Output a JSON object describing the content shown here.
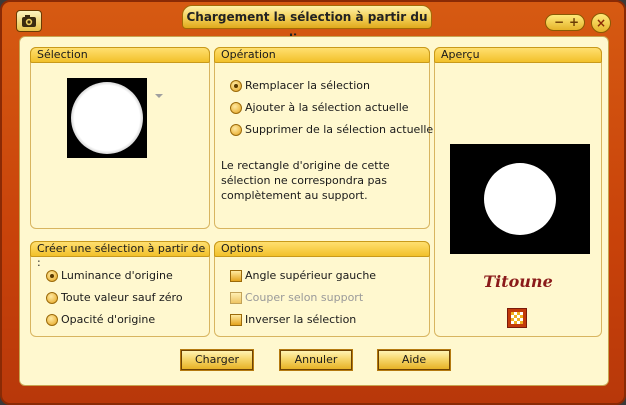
{
  "window": {
    "title": "Chargement la sélection à partir du disque"
  },
  "controls": {
    "minimize": "−",
    "maximize": "+",
    "close": "×"
  },
  "groups": {
    "selection": {
      "label": "Sélection"
    },
    "operation": {
      "label": "Opération",
      "options": [
        "Remplacer la sélection",
        "Ajouter à la sélection actuelle",
        "Supprimer de la sélection actuelle"
      ],
      "selected_index": 0,
      "description": "Le rectangle d'origine de cette sélection ne correspondra pas complètement au support."
    },
    "preview": {
      "label": "Aperçu",
      "watermark": "Titoune"
    },
    "create_from": {
      "label": "Créer une sélection à partir de :",
      "options": [
        "Luminance d'origine",
        "Toute valeur sauf zéro",
        "Opacité d'origine"
      ],
      "selected_index": 0
    },
    "options": {
      "label": "Options",
      "checkboxes": [
        {
          "label": "Angle supérieur gauche",
          "checked": false,
          "enabled": true
        },
        {
          "label": "Couper selon support",
          "checked": false,
          "enabled": false
        },
        {
          "label": "Inverser la sélection",
          "checked": false,
          "enabled": true
        }
      ]
    }
  },
  "buttons": {
    "load": "Charger",
    "cancel": "Annuler",
    "help": "Aide"
  },
  "colors": {
    "frame": "#c8420a",
    "panel": "#fff8cf",
    "header": "#f2c12b",
    "accent": "#e5b42a"
  }
}
